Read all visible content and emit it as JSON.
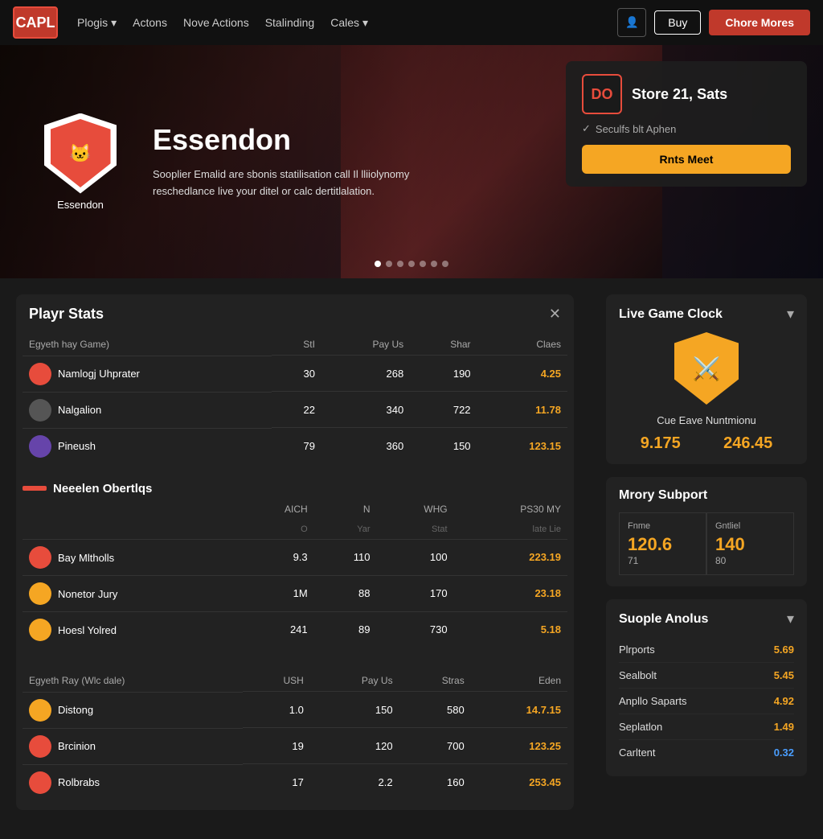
{
  "nav": {
    "logo_text": "CAPL",
    "links": [
      {
        "label": "Plogis",
        "has_dropdown": true
      },
      {
        "label": "Actons",
        "has_dropdown": false
      },
      {
        "label": "Nove Actions",
        "has_dropdown": false
      },
      {
        "label": "Stalinding",
        "has_dropdown": false
      },
      {
        "label": "Cales",
        "has_dropdown": true
      }
    ],
    "btn_buy": "Buy",
    "btn_chore": "Chore Mores"
  },
  "hero": {
    "team_name": "Essendon",
    "title": "Essendon",
    "desc": "Sooplier Emalid are sbonis statilisation call Il lliiolynomy reschedlance live your ditel or calc dertitlalation.",
    "card": {
      "logo_text": "DO",
      "title_pre": "Store",
      "title_bold": "21,",
      "title_post": "Sats",
      "check_text": "Seculfs blt Aphen",
      "btn_label": "Rnts Meet"
    },
    "dots": [
      true,
      false,
      false,
      false,
      false,
      false,
      false
    ]
  },
  "player_stats": {
    "title": "Playr Stats",
    "table1": {
      "headers": [
        "Egyeth hay Game)",
        "StI",
        "Pay Us",
        "Shar",
        "Claes"
      ],
      "rows": [
        {
          "name": "Namlogj Uhprater",
          "icon_color": "#e74c3c",
          "col1": "30",
          "col2": "268",
          "col3": "190",
          "val": "4.25"
        },
        {
          "name": "Nalgalion",
          "icon_color": "#555",
          "col1": "22",
          "col2": "340",
          "col3": "722",
          "val": "11.78"
        },
        {
          "name": "Pineush",
          "icon_color": "#6644aa",
          "col1": "79",
          "col2": "360",
          "col3": "150",
          "val": "123.15"
        }
      ]
    },
    "section2": {
      "label": "Neeelen Obertlqs",
      "col_labels": [
        "AICH",
        "N",
        "WHG",
        "PS30 MY"
      ],
      "sub_labels": [
        "O",
        "Yar",
        "Stat",
        "late Lie"
      ],
      "rows": [
        {
          "name": "Bay Mltholls",
          "icon_color": "#e74c3c",
          "col1": "9.3",
          "col2": "110",
          "col3": "100",
          "val": "223.19"
        },
        {
          "name": "Nonetor Jury",
          "icon_color": "#f5a623",
          "col1": "1M",
          "col2": "88",
          "col3": "170",
          "val": "23.18"
        },
        {
          "name": "Hoesl Yolred",
          "icon_color": "#f5a623",
          "col1": "241",
          "col2": "89",
          "col3": "730",
          "val": "5.18"
        }
      ]
    },
    "table3": {
      "headers": [
        "Egyeth Ray (Wlc dale)",
        "USH",
        "Pay Us",
        "Stras",
        "Eden"
      ],
      "rows": [
        {
          "name": "Distong",
          "icon_color": "#f5a623",
          "col1": "1.0",
          "col2": "150",
          "col3": "580",
          "val": "14.7.15"
        },
        {
          "name": "Brcinion",
          "icon_color": "#e74c3c",
          "col1": "19",
          "col2": "120",
          "col3": "700",
          "val": "123.25"
        },
        {
          "name": "Rolbrabs",
          "icon_color": "#e74c3c",
          "col1": "17",
          "col2": "2.2",
          "col3": "160",
          "val": "253.45"
        }
      ]
    }
  },
  "live_game_clock": {
    "title": "Live Game Clock",
    "team_label": "Cue Eave Nuntmionu",
    "score1": "9.175",
    "score2": "246.45"
  },
  "mrory_support": {
    "title": "Mrory Subport",
    "items": [
      {
        "label": "Fnme",
        "value": "120.6",
        "sub": "71"
      },
      {
        "label": "Gntliel",
        "value": "140",
        "sub": "80"
      }
    ]
  },
  "suople_anolus": {
    "title": "Suople Anolus",
    "rows": [
      {
        "name": "Plrports",
        "val": "5.69",
        "color": "gold"
      },
      {
        "name": "Sealbolt",
        "val": "5.45",
        "color": "gold"
      },
      {
        "name": "Anpllo Saparts",
        "val": "4.92",
        "color": "gold"
      },
      {
        "name": "Seplatlon",
        "val": "1.49",
        "color": "gold"
      },
      {
        "name": "Carltent",
        "val": "0.32",
        "color": "blue"
      }
    ]
  }
}
